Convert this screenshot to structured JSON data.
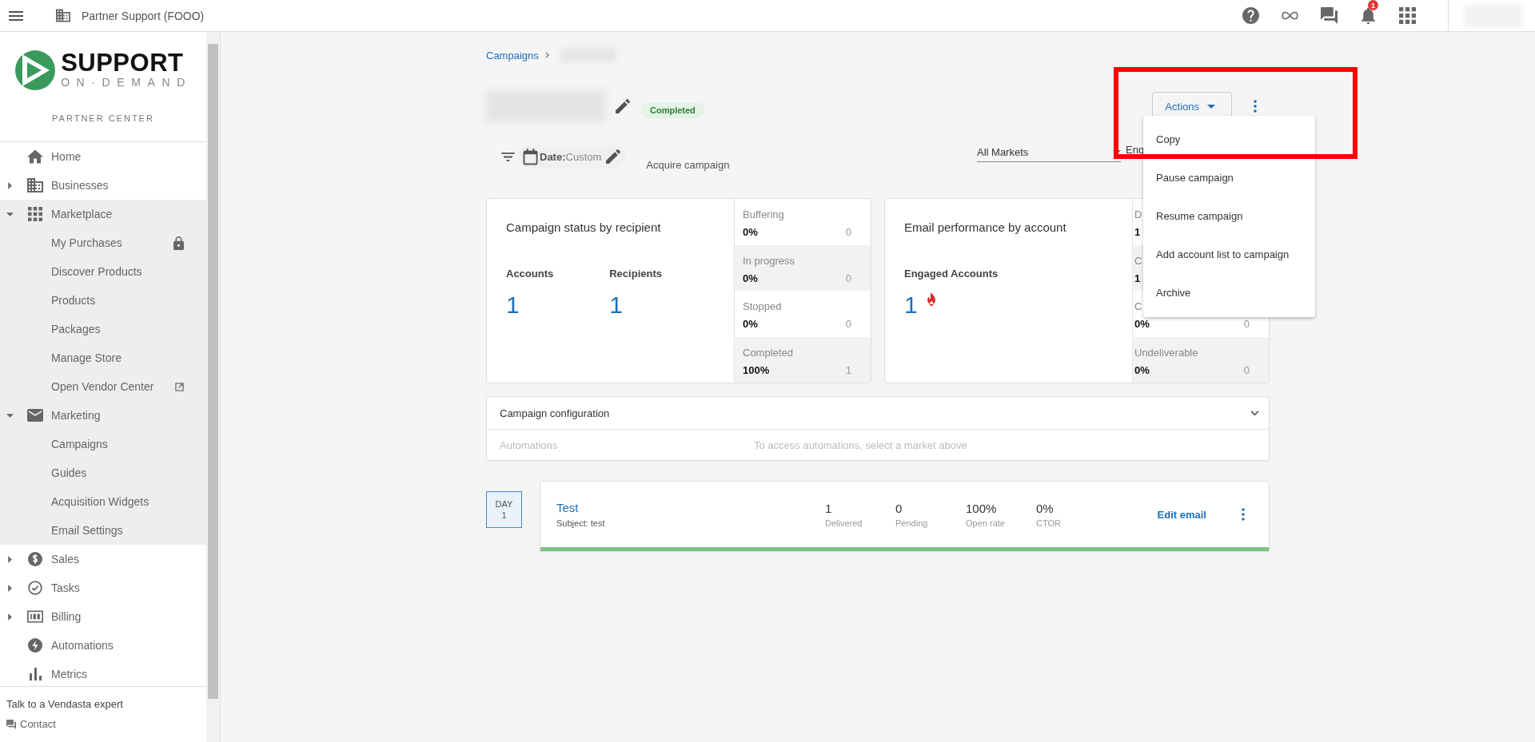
{
  "top_bar": {
    "account": "Partner Support (FOOO)",
    "notification_count": "1"
  },
  "sidebar": {
    "logo": {
      "word": "SUPPORT",
      "tagline": "ON·DEMAND"
    },
    "subtitle": "PARTNER CENTER",
    "items": [
      {
        "label": "Home",
        "kind": "link"
      },
      {
        "label": "Businesses",
        "kind": "group",
        "expanded": false
      },
      {
        "label": "Marketplace",
        "kind": "group",
        "expanded": true,
        "children": [
          {
            "label": "My Purchases",
            "kind": "locked"
          },
          {
            "label": "Discover Products",
            "kind": "link"
          },
          {
            "label": "Products",
            "kind": "link"
          },
          {
            "label": "Packages",
            "kind": "link"
          },
          {
            "label": "Manage Store",
            "kind": "link"
          },
          {
            "label": "Open Vendor Center",
            "kind": "external"
          }
        ]
      },
      {
        "label": "Marketing",
        "kind": "group",
        "expanded": true,
        "children": [
          {
            "label": "Campaigns",
            "kind": "link"
          },
          {
            "label": "Guides",
            "kind": "link"
          },
          {
            "label": "Acquisition Widgets",
            "kind": "link"
          },
          {
            "label": "Email Settings",
            "kind": "link"
          }
        ]
      },
      {
        "label": "Sales",
        "kind": "group",
        "expanded": false
      },
      {
        "label": "Tasks",
        "kind": "group",
        "expanded": false
      },
      {
        "label": "Billing",
        "kind": "group",
        "expanded": false
      },
      {
        "label": "Automations",
        "kind": "link"
      },
      {
        "label": "Metrics",
        "kind": "link"
      }
    ],
    "footer": {
      "title": "Talk to a Vendasta expert",
      "contact": "Contact"
    }
  },
  "breadcrumb": [
    "Campaigns"
  ],
  "campaign": {
    "status": "Completed"
  },
  "actions": {
    "label": "Actions",
    "expanded": true,
    "menu": [
      "Copy",
      "Pause campaign",
      "Resume campaign",
      "Add account list to campaign",
      "Archive"
    ]
  },
  "filters": {
    "date_label": "Date:",
    "date_value": "Custom",
    "type": "Acquire campaign",
    "market": "All Markets",
    "language": "Eng"
  },
  "cards": [
    {
      "title": "Campaign status by recipient",
      "metrics": [
        {
          "label": "Accounts",
          "value": "1",
          "hot": false
        },
        {
          "label": "Recipients",
          "value": "1",
          "hot": false
        }
      ],
      "stats": [
        {
          "label": "Buffering",
          "percent": "0%",
          "count": "0"
        },
        {
          "label": "In progress",
          "percent": "0%",
          "count": "0"
        },
        {
          "label": "Stopped",
          "percent": "0%",
          "count": "0"
        },
        {
          "label": "Completed",
          "percent": "100%",
          "count": "1"
        }
      ]
    },
    {
      "title": "Email performance by account",
      "metrics": [
        {
          "label": "Engaged Accounts",
          "value": "1",
          "hot": true
        }
      ],
      "stats": [
        {
          "label": "D",
          "percent": "1"
        },
        {
          "label": "C",
          "percent": "1"
        },
        {
          "label": "C",
          "percent": "0%",
          "count": "0"
        },
        {
          "label": "Undeliverable",
          "percent": "0%",
          "count": "0"
        }
      ]
    }
  ],
  "configuration": {
    "title": "Campaign configuration",
    "expanded": false,
    "rows": [
      {
        "label": "Automations",
        "note": "To access automations, select a market above"
      }
    ]
  },
  "emails": [
    {
      "day_label": "DAY",
      "day": "1",
      "title": "Test",
      "subject": "Subject: test",
      "level": 1,
      "edit": "Edit email",
      "stats": [
        {
          "value": "1",
          "label": "Delivered"
        },
        {
          "value": "0",
          "label": "Pending"
        },
        {
          "value": "100%",
          "label": "Open rate"
        },
        {
          "value": "0%",
          "label": "CTOR"
        }
      ]
    }
  ]
}
